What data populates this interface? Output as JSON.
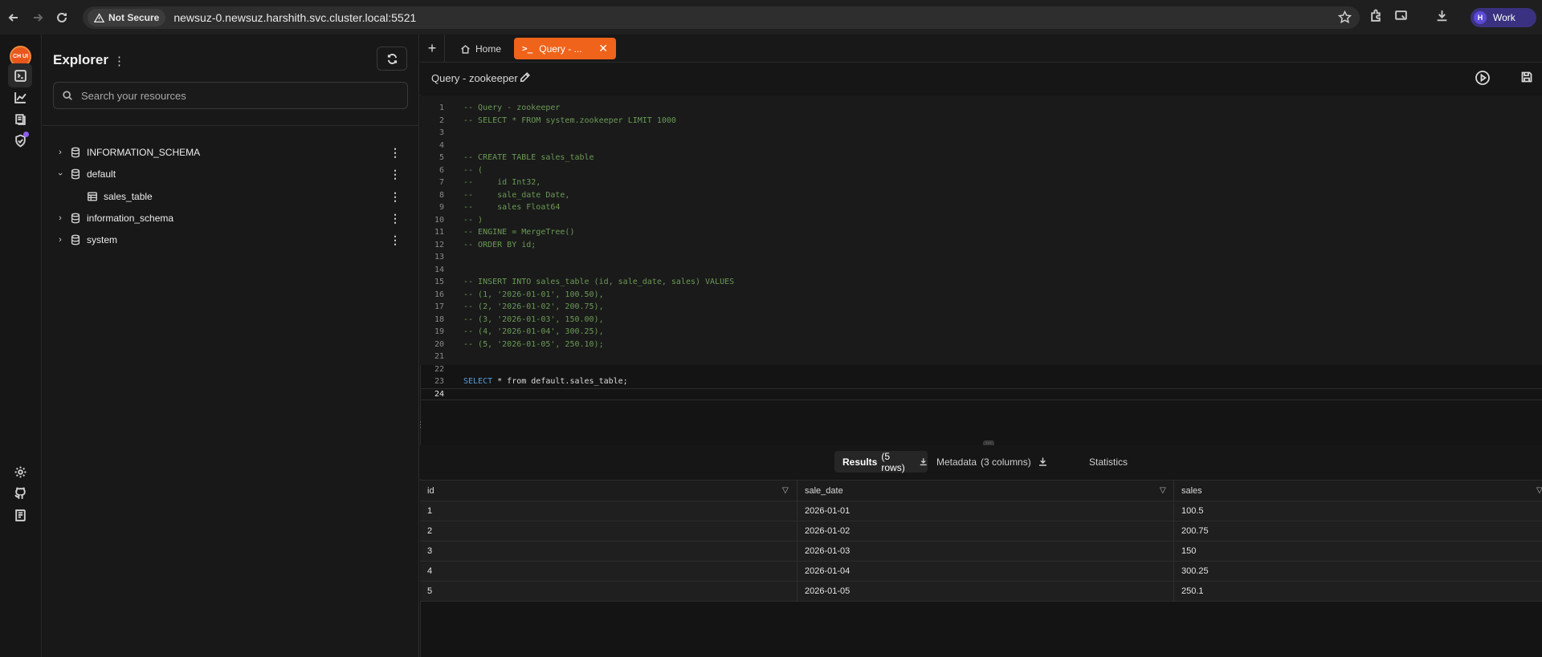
{
  "browser": {
    "security_label": "Not Secure",
    "url": "newsuz-0.newsuz.harshith.svc.cluster.local:5521",
    "profile_initial": "H",
    "profile_name": "Work"
  },
  "app": {
    "logo_text": "CH UI"
  },
  "explorer": {
    "title": "Explorer",
    "search_placeholder": "Search your resources",
    "tree": [
      {
        "label": "INFORMATION_SCHEMA",
        "expanded": false,
        "level": 0,
        "icon": "database-icon"
      },
      {
        "label": "default",
        "expanded": true,
        "level": 0,
        "icon": "database-icon"
      },
      {
        "label": "sales_table",
        "level": 1,
        "icon": "table-icon"
      },
      {
        "label": "information_schema",
        "expanded": false,
        "level": 0,
        "icon": "database-icon"
      },
      {
        "label": "system",
        "expanded": false,
        "level": 0,
        "icon": "database-icon"
      }
    ]
  },
  "tabs": {
    "home_label": "Home",
    "query_label": "Query - ..."
  },
  "query": {
    "title": "Query - zookeeper",
    "lines": [
      "-- Query - zookeeper",
      "-- SELECT * FROM system.zookeeper LIMIT 1000",
      "",
      "",
      "-- CREATE TABLE sales_table",
      "-- (",
      "--     id Int32,",
      "--     sale_date Date,",
      "--     sales Float64",
      "-- )",
      "-- ENGINE = MergeTree()",
      "-- ORDER BY id;",
      "",
      "",
      "-- INSERT INTO sales_table (id, sale_date, sales) VALUES",
      "-- (1, '2026-01-01', 100.50),",
      "-- (2, '2026-01-02', 200.75),",
      "-- (3, '2026-01-03', 150.00),",
      "-- (4, '2026-01-04', 300.25),",
      "-- (5, '2026-01-05', 250.10);",
      "",
      "",
      "SELECT * from default.sales_table;",
      ""
    ],
    "current_line": 24
  },
  "results": {
    "tabs": {
      "results_label": "Results",
      "results_count": "(5 rows)",
      "metadata_label": "Metadata",
      "metadata_count": "(3 columns)",
      "statistics_label": "Statistics"
    },
    "columns": [
      "id",
      "sale_date",
      "sales"
    ],
    "rows": [
      [
        "1",
        "2026-01-01",
        "100.5"
      ],
      [
        "2",
        "2026-01-02",
        "200.75"
      ],
      [
        "3",
        "2026-01-03",
        "150"
      ],
      [
        "4",
        "2026-01-04",
        "300.25"
      ],
      [
        "5",
        "2026-01-05",
        "250.1"
      ]
    ]
  }
}
